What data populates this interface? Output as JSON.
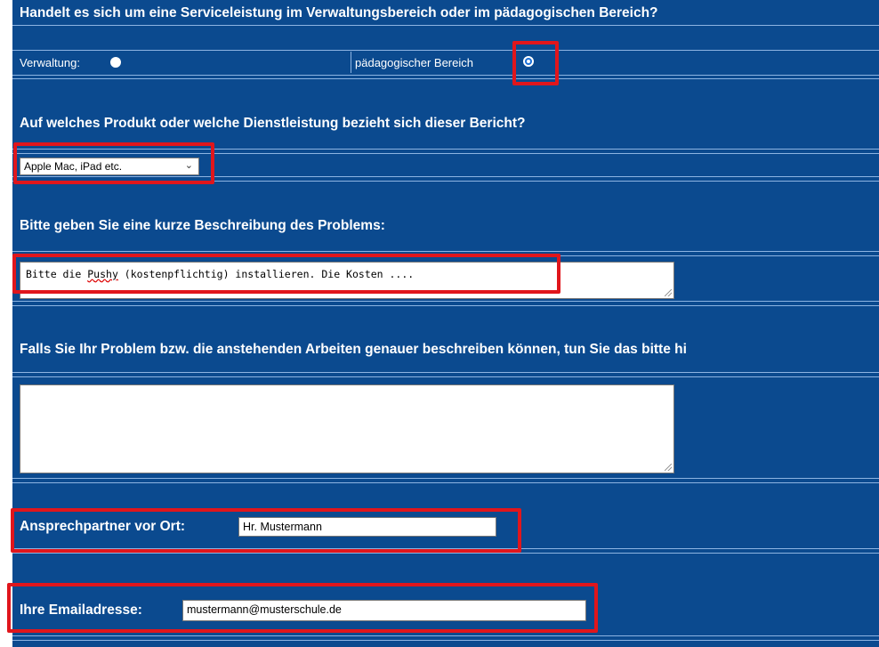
{
  "section1": {
    "question": "Handelt es sich um eine Serviceleistung im Verwaltungsbereich oder im pädagogischen Bereich?",
    "option_admin_label": "Verwaltung:",
    "option_pedagogic_label": "pädagogischer Bereich",
    "selected": "pädagogischer Bereich"
  },
  "section2": {
    "question": "Auf welches Produkt oder welche Dienstleistung bezieht sich dieser Bericht?",
    "selected_value": "Apple Mac, iPad etc."
  },
  "section3": {
    "question": "Bitte geben Sie eine kurze Beschreibung des Problems:",
    "text_before": "Bitte die ",
    "text_misspelled": "Pushy",
    "text_after": " (kostenpflichtig) installieren. Die Kosten ...."
  },
  "section4": {
    "question": "Falls Sie Ihr Problem bzw. die anstehenden Arbeiten genauer beschreiben können, tun Sie das bitte hi",
    "value": ""
  },
  "section5": {
    "label": "Ansprechpartner vor Ort:",
    "value": "Hr. Mustermann"
  },
  "section6": {
    "label": "Ihre Emailadresse:",
    "value": "mustermann@musterschule.de"
  },
  "colors": {
    "background": "#0b4a8f",
    "highlight": "#e0161c",
    "line": "#8db4e2"
  }
}
